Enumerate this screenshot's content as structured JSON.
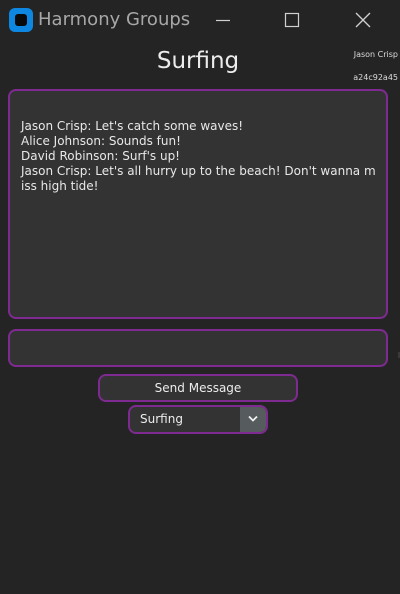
{
  "window": {
    "title": "Harmony Groups"
  },
  "account": {
    "username": "Jason Crisp",
    "user_id": "a24c92a45"
  },
  "group": {
    "title": "Surfing"
  },
  "chat": {
    "messages": [
      "Jason Crisp: Let's catch some waves!",
      "Alice Johnson: Sounds fun!",
      "David Robinson: Surf's up!",
      "Jason Crisp: Let's all hurry up to the beach! Don't wanna miss high tide!"
    ]
  },
  "composer": {
    "value": "",
    "placeholder": ""
  },
  "actions": {
    "send_label": "Send Message"
  },
  "group_selector": {
    "selected": "Surfing"
  },
  "colors": {
    "background": "#242424",
    "field_background": "#333333",
    "accent_border": "#7e2a91",
    "app_icon": "#0d87e0",
    "dropdown_button": "#565b5e"
  },
  "icons": {
    "app": "app-icon",
    "minimize": "minimize-icon",
    "maximize": "maximize-icon",
    "close": "close-icon",
    "dropdown": "chevron-down-icon"
  }
}
